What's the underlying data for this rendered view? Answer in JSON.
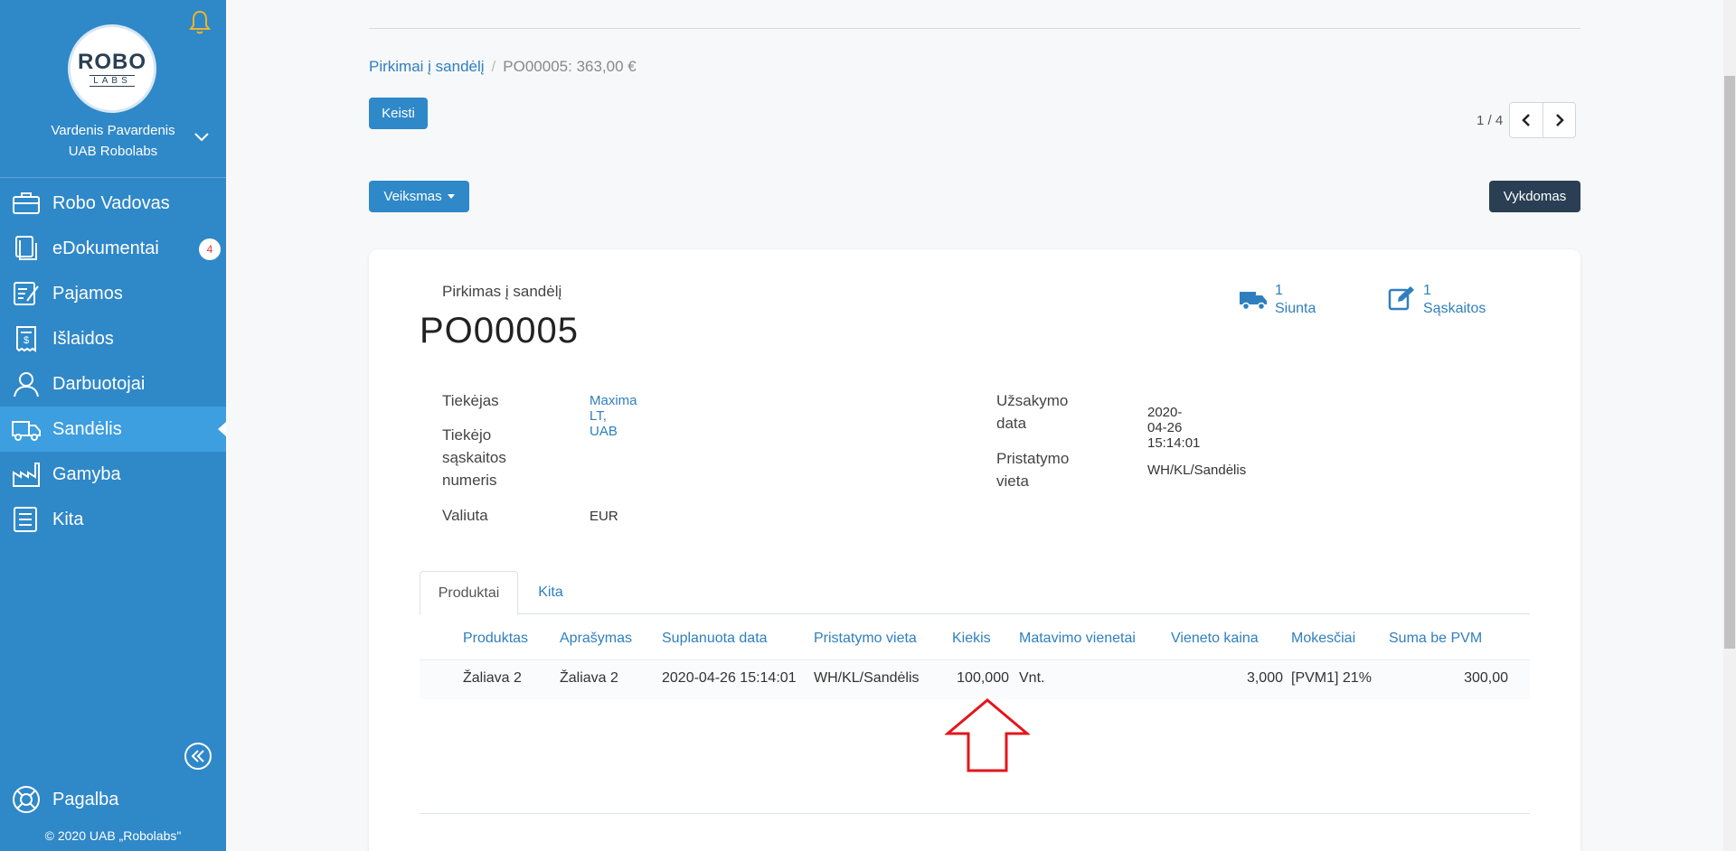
{
  "sidebar": {
    "logo_top": "ROBO",
    "logo_bottom": "LABS",
    "user_name": "Vardenis Pavardenis",
    "company": "UAB Robolabs",
    "items": [
      {
        "label": "Robo Vadovas",
        "icon": "briefcase-icon"
      },
      {
        "label": "eDokumentai",
        "icon": "documents-icon",
        "badge": "4"
      },
      {
        "label": "Pajamos",
        "icon": "edit-document-icon"
      },
      {
        "label": "Išlaidos",
        "icon": "receipt-icon"
      },
      {
        "label": "Darbuotojai",
        "icon": "person-icon"
      },
      {
        "label": "Sandėlis",
        "icon": "truck-icon",
        "active": true
      },
      {
        "label": "Gamyba",
        "icon": "factory-icon"
      },
      {
        "label": "Kita",
        "icon": "list-icon"
      }
    ],
    "help": "Pagalba",
    "copyright": "© 2020 UAB „Robolabs\""
  },
  "breadcrumb": {
    "parent": "Pirkimai į sandėlį",
    "separator": "/",
    "current": "PO00005: 363,00 €"
  },
  "buttons": {
    "edit": "Keisti",
    "action": "Veiksmas",
    "status": "Vykdomas"
  },
  "pager": {
    "text": "1 / 4"
  },
  "document": {
    "type": "Pirkimas į sandėlį",
    "number": "PO00005",
    "smart_buttons": [
      {
        "count": "1",
        "label": "Siunta"
      },
      {
        "count": "1",
        "label": "Sąskaitos"
      }
    ],
    "fields": {
      "supplier_label": "Tiekėjas",
      "supplier_value": "Maxima LT, UAB",
      "supplier_invoice_label_1": "Tiekėjo",
      "supplier_invoice_label_2": "sąskaitos",
      "supplier_invoice_label_3": "numeris",
      "currency_label": "Valiuta",
      "currency_value": "EUR",
      "order_date_label_1": "Užsakymo",
      "order_date_label_2": "data",
      "order_date_value": "2020-04-26 15:14:01",
      "delivery_label_1": "Pristatymo",
      "delivery_label_2": "vieta",
      "delivery_value": "WH/KL/Sandėlis"
    },
    "tabs": [
      "Produktai",
      "Kita"
    ],
    "table": {
      "headers": [
        "Produktas",
        "Aprašymas",
        "Suplanuota data",
        "Pristatymo vieta",
        "Kiekis",
        "Matavimo vienetai",
        "Vieneto kaina",
        "Mokesčiai",
        "Suma be PVM"
      ],
      "rows": [
        [
          "Žaliava 2",
          "Žaliava 2",
          "2020-04-26 15:14:01",
          "WH/KL/Sandėlis",
          "100,000",
          "Vnt.",
          "3,000",
          "[PVM1] 21%",
          "300,00"
        ]
      ]
    }
  },
  "colors": {
    "sidebar": "#2f88c8",
    "sidebar_active": "#3d9ee0",
    "link": "#2f7fbf",
    "status_dark": "#2a3f54",
    "annotation_arrow": "#e3161b"
  }
}
